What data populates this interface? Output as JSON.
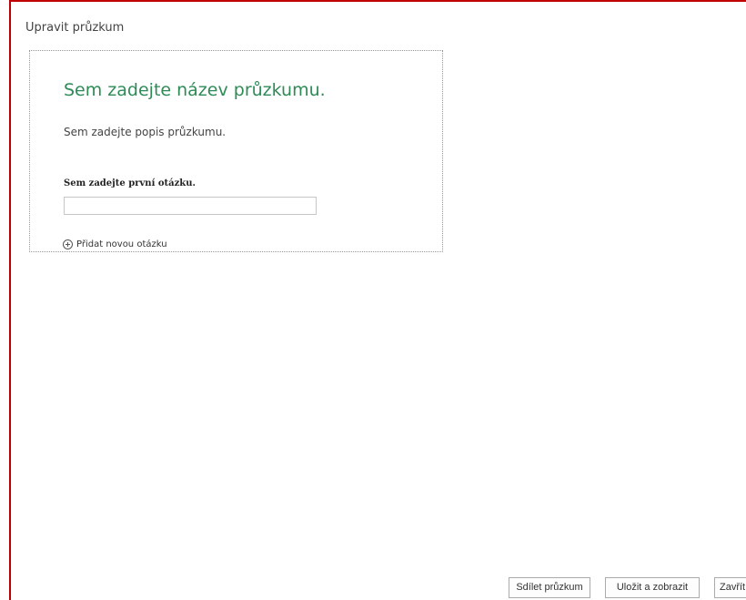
{
  "window": {
    "title": "Upravit průzkum"
  },
  "survey": {
    "title_placeholder": "Sem zadejte název průzkumu.",
    "description_placeholder": "Sem zadejte popis průzkumu.",
    "first_question_placeholder": "Sem zadejte první otázku.",
    "answer_value": "",
    "add_question_label": "Přidat novou otázku"
  },
  "footer": {
    "share_label": "Sdílet průzkum",
    "save_view_label": "Uložit a zobrazit",
    "close_label": "Zavřít"
  },
  "colors": {
    "frame_border": "#c00000",
    "title_accent": "#2e8b57"
  },
  "icons": {
    "add_question": "plus-circle-icon"
  }
}
